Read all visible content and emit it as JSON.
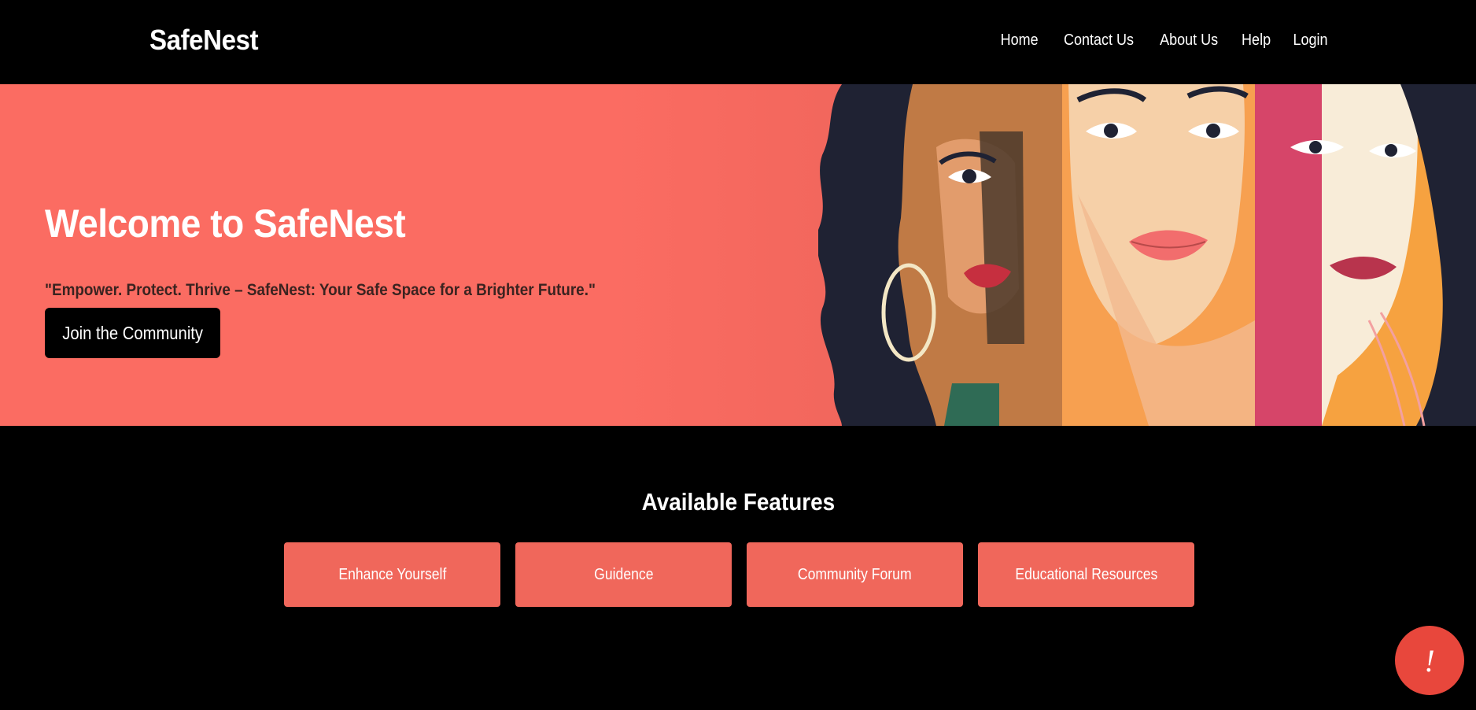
{
  "header": {
    "brand": "SafeNest",
    "nav": [
      "Home",
      "Contact Us",
      "About Us",
      "Help",
      "Login"
    ]
  },
  "hero": {
    "title": "Welcome to SafeNest",
    "tagline": "\"Empower. Protect. Thrive – SafeNest: Your Safe Space for a Brighter Future.\"",
    "cta_label": "Join the Community"
  },
  "features": {
    "title": "Available Features",
    "items": [
      "Enhance Yourself",
      "Guidence",
      "Community Forum",
      "Educational Resources"
    ]
  },
  "alert_fab": {
    "label": "!"
  },
  "colors": {
    "background": "#000000",
    "hero_bg": "#fb6c62",
    "feature_card": "#f0675b",
    "alert_fab": "#e8473c"
  }
}
